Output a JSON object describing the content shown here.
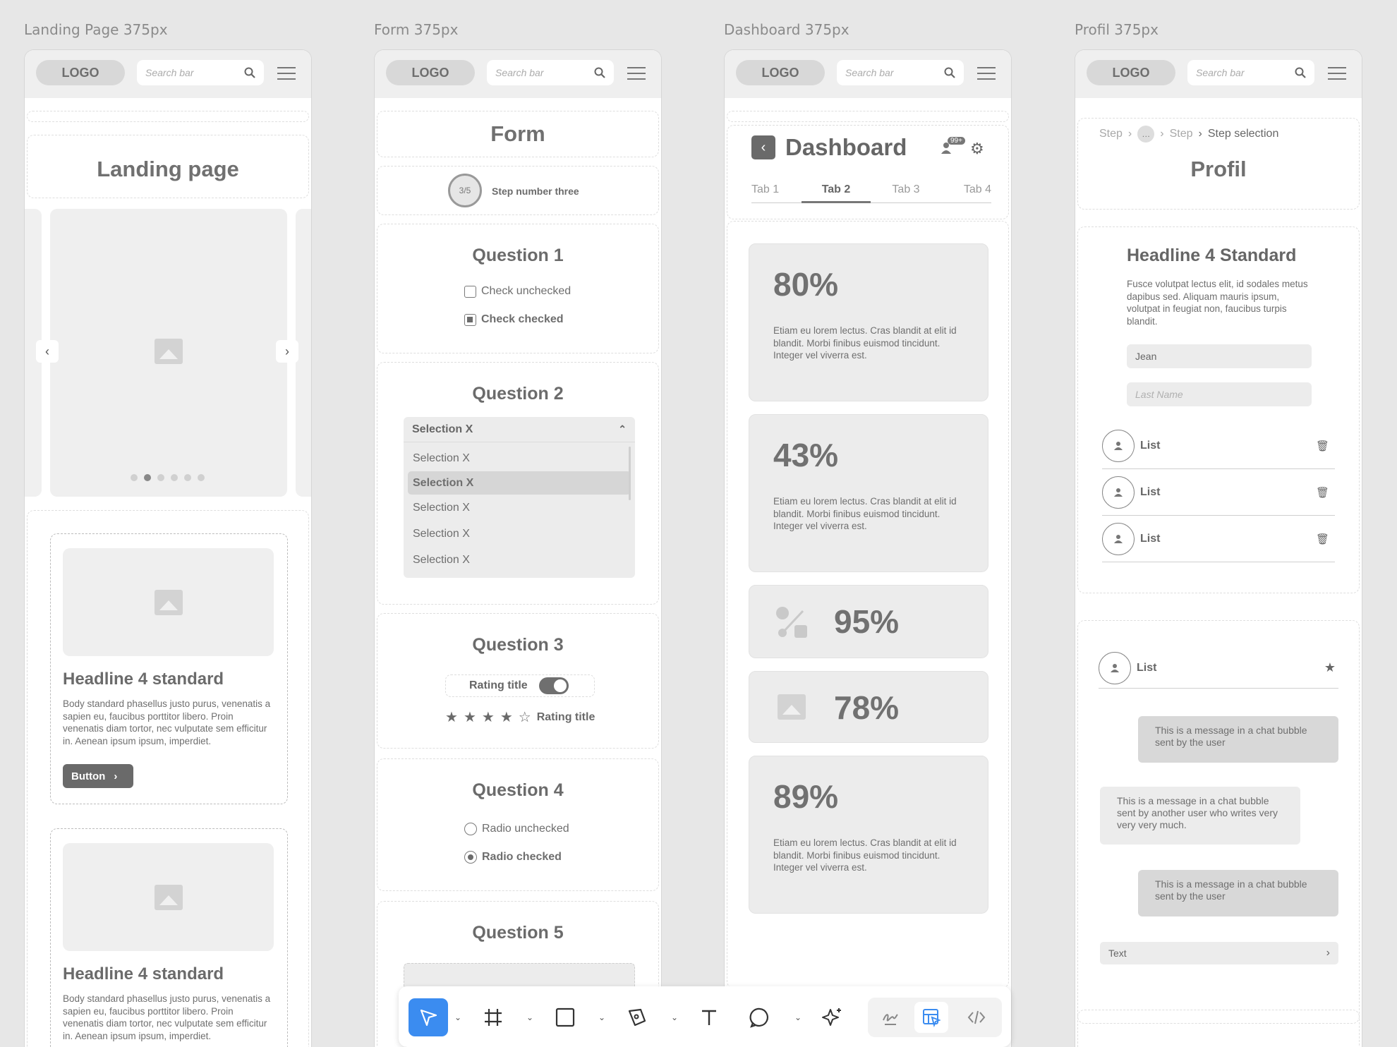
{
  "frames": {
    "landing": "Landing Page 375px",
    "form": "Form 375px",
    "dashboard": "Dashboard 375px",
    "profil": "Profil 375px"
  },
  "header": {
    "logo": "LOGO",
    "search_placeholder": "Search bar"
  },
  "landing": {
    "title": "Landing page",
    "cards": [
      {
        "headline": "Headline 4 standard",
        "body": "Body standard phasellus justo purus, venenatis a sapien eu, faucibus porttitor libero. Proin venenatis diam tortor, nec vulputate sem efficitur in. Aenean ipsum ipsum, imperdiet.",
        "button": "Button"
      },
      {
        "headline": "Headline 4 standard",
        "body": "Body standard phasellus justo purus, venenatis a sapien eu, faucibus porttitor libero. Proin venenatis diam tortor, nec vulputate sem efficitur in. Aenean ipsum ipsum, imperdiet."
      }
    ]
  },
  "form": {
    "title": "Form",
    "step_badge": "3/5",
    "step_label": "Step number three",
    "q1": {
      "title": "Question 1",
      "unchecked": "Check unchecked",
      "checked": "Check checked"
    },
    "q2": {
      "title": "Question 2",
      "selected_header": "Selection X",
      "options": [
        "Selection X",
        "Selection X",
        "Selection X",
        "Selection X",
        "Selection X"
      ]
    },
    "q3": {
      "title": "Question 3",
      "rating_title": "Rating title",
      "rating_title2": "Rating title",
      "stars_filled": 4,
      "stars_total": 5
    },
    "q4": {
      "title": "Question 4",
      "unchecked": "Radio unchecked",
      "checked": "Radio checked"
    },
    "q5": {
      "title": "Question 5"
    }
  },
  "dashboard": {
    "title": "Dashboard",
    "badge": "99+",
    "tabs": [
      "Tab 1",
      "Tab 2",
      "Tab 3",
      "Tab 4"
    ],
    "cards": [
      {
        "value": "80%",
        "text": "Etiam eu lorem lectus. Cras blandit at elit id blandit. Morbi finibus euismod tincidunt. Integer vel viverra est."
      },
      {
        "value": "43%",
        "text": "Etiam eu lorem lectus. Cras blandit at elit id blandit. Morbi finibus euismod tincidunt. Integer vel viverra est."
      },
      {
        "value": "95%"
      },
      {
        "value": "78%"
      },
      {
        "value": "89%",
        "text": "Etiam eu lorem lectus. Cras blandit at elit id blandit. Morbi finibus euismod tincidunt. Integer vel viverra est."
      }
    ]
  },
  "profil": {
    "breadcrumb": [
      "Step",
      "…",
      "Step",
      "Step selection"
    ],
    "title": "Profil",
    "headline": "Headline 4 Standard",
    "body": "Fusce volutpat lectus elit, id sodales metus dapibus sed. Aliquam mauris ipsum, volutpat in feugiat non, faucibus turpis blandit.",
    "first_name": "Jean",
    "last_name_placeholder": "Last Name",
    "list": [
      "List",
      "List",
      "List"
    ],
    "list4": "List",
    "bubbles": [
      "This is a message in a chat bubble sent by the user",
      "This is a message in a chat bubble sent by another user who writes very very very much.",
      "This is a message in a chat bubble sent by the user"
    ],
    "text_field": "Text"
  },
  "toolbar": {
    "tools": [
      "select-tool",
      "frame-tool",
      "rectangle-tool",
      "pen-tool",
      "text-tool",
      "comment-tool",
      "ai-tool",
      "draw-mode",
      "dev-mode",
      "code-view"
    ]
  }
}
